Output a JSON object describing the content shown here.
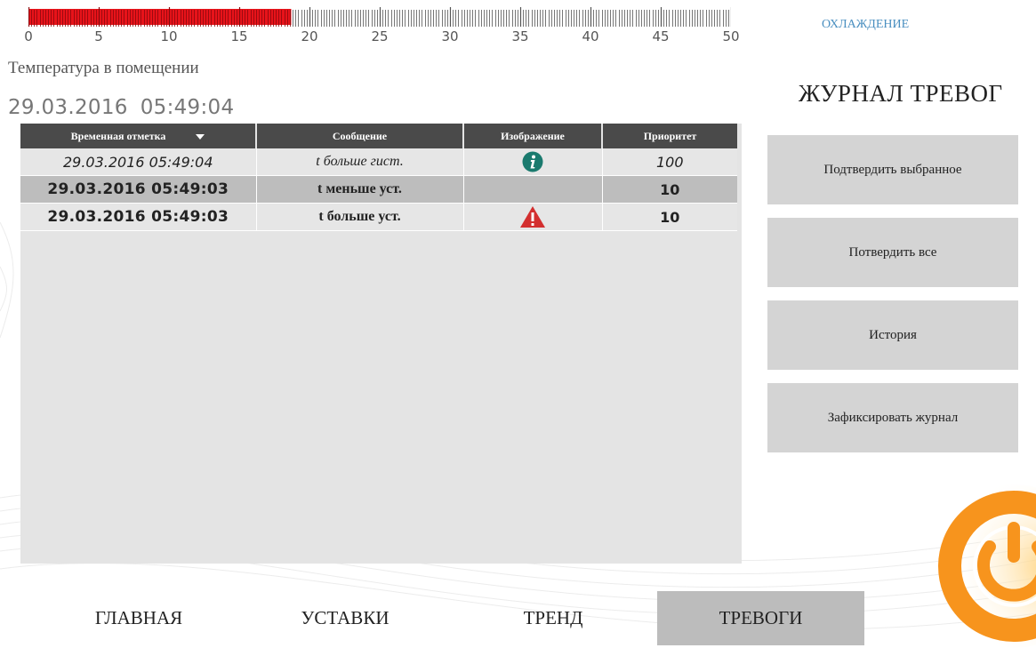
{
  "temperature": {
    "value": 18.7,
    "scale_min": 0,
    "scale_max": 50,
    "tick_labels": [
      "0",
      "5",
      "10",
      "15",
      "20",
      "25",
      "30",
      "35",
      "40",
      "45",
      "50"
    ],
    "fill_color": "#e8131a",
    "label": "Температура в помещении"
  },
  "mode_link": "ОХЛАЖДЕНИЕ",
  "datetime": {
    "date": "29.03.2016",
    "time": "05:49:04"
  },
  "page_title": "ЖУРНАЛ ТРЕВОГ",
  "alarm_table": {
    "headers": [
      "Временная отметка",
      "Сообщение",
      "Изображение",
      "Приоритет"
    ],
    "rows": [
      {
        "timestamp": "29.03.2016 05:49:04",
        "message": "t больше гист.",
        "icon": "info-icon",
        "priority": "100"
      },
      {
        "timestamp": "29.03.2016 05:49:03",
        "message": "t меньше уст.",
        "icon": "",
        "priority": "10"
      },
      {
        "timestamp": "29.03.2016 05:49:03",
        "message": "t больше уст.",
        "icon": "warning-icon",
        "priority": "10"
      }
    ]
  },
  "buttons": {
    "confirm_selected": "Подтвердить выбранное",
    "confirm_all": "Потвердить все",
    "history": "История",
    "lock_log": "Зафиксировать журнал"
  },
  "nav": {
    "main": "ГЛАВНАЯ",
    "setpoints": "УСТАВКИ",
    "trend": "ТРЕНД",
    "alarms": "ТРЕВОГИ"
  },
  "colors": {
    "accent_orange": "#f7941d",
    "info_teal": "#1a7a6e",
    "warning_red": "#d32f2f",
    "link_blue": "#4a8fc0"
  }
}
